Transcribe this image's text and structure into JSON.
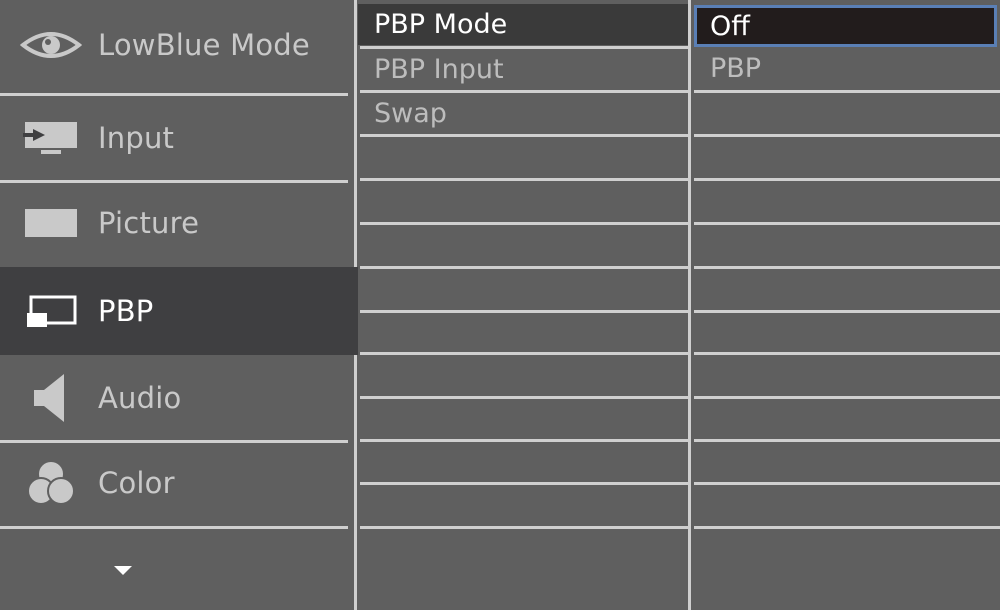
{
  "main_menu": {
    "items": [
      {
        "label": "LowBlue Mode",
        "icon": "eye-icon"
      },
      {
        "label": "Input",
        "icon": "input-icon"
      },
      {
        "label": "Picture",
        "icon": "picture-icon"
      },
      {
        "label": "PBP",
        "icon": "pbp-icon",
        "active": true
      },
      {
        "label": "Audio",
        "icon": "speaker-icon"
      },
      {
        "label": "Color",
        "icon": "color-icon"
      }
    ],
    "more_icon": "chevron-down-icon"
  },
  "submenu": {
    "items": [
      "PBP Mode",
      "PBP Input",
      "Swap"
    ],
    "selected": "PBP Mode"
  },
  "options": {
    "items": [
      "Off",
      "PBP"
    ],
    "selected": "Off"
  },
  "colors": {
    "background": "#5f5f5f",
    "active_item": "#3f3f41",
    "selection_border": "#5a7fb5",
    "separator": "#cfcfcf"
  }
}
